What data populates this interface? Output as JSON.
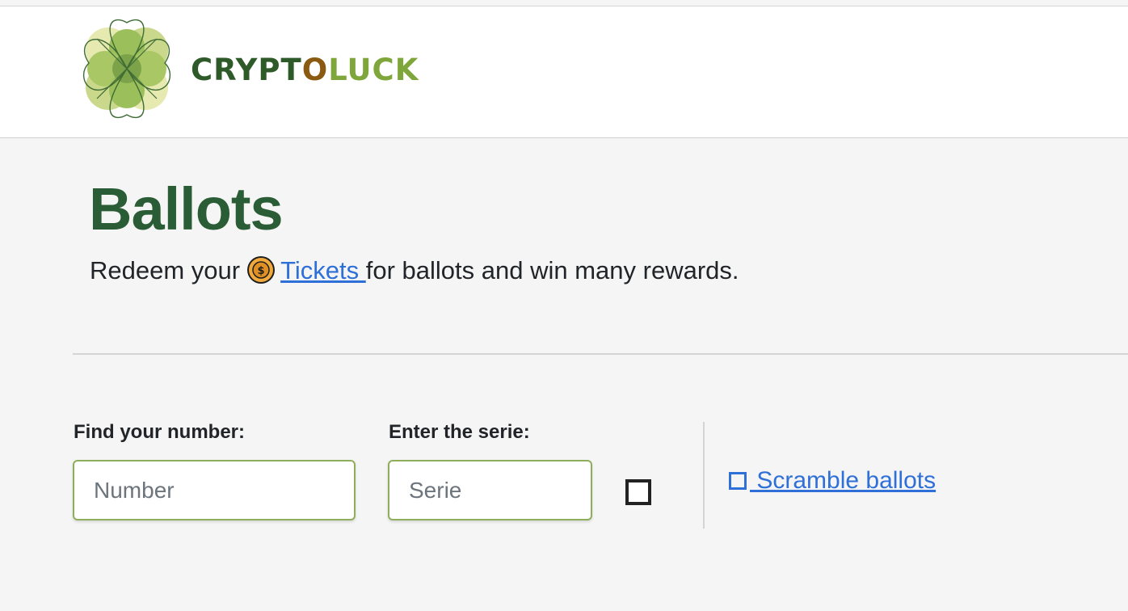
{
  "header": {
    "logo": {
      "text_part1": "CRYPT",
      "text_part2": "O",
      "text_part3": "LUCK",
      "colors": {
        "dark_green": "#2e5a2a",
        "brown": "#8a5a10",
        "light_green": "#7fa63a"
      },
      "icon": "four-leaf-clover-icon"
    }
  },
  "main": {
    "title": "Ballots",
    "subtitle": {
      "before": "Redeem your",
      "coin_icon": "coin-icon",
      "link_text": "Tickets ",
      "after": "for ballots and win many rewards."
    },
    "filters": {
      "number_label": "Find your number:",
      "number_placeholder": "Number",
      "serie_label": "Enter the serie:",
      "serie_placeholder": "Serie",
      "checkbox_checked": false,
      "scramble_label": " Scramble ballots",
      "scramble_icon": "square-icon"
    }
  },
  "colors": {
    "title": "#2a5d35",
    "link": "#2f6fd8",
    "input_border": "#8fae5c",
    "background": "#f5f5f5"
  }
}
